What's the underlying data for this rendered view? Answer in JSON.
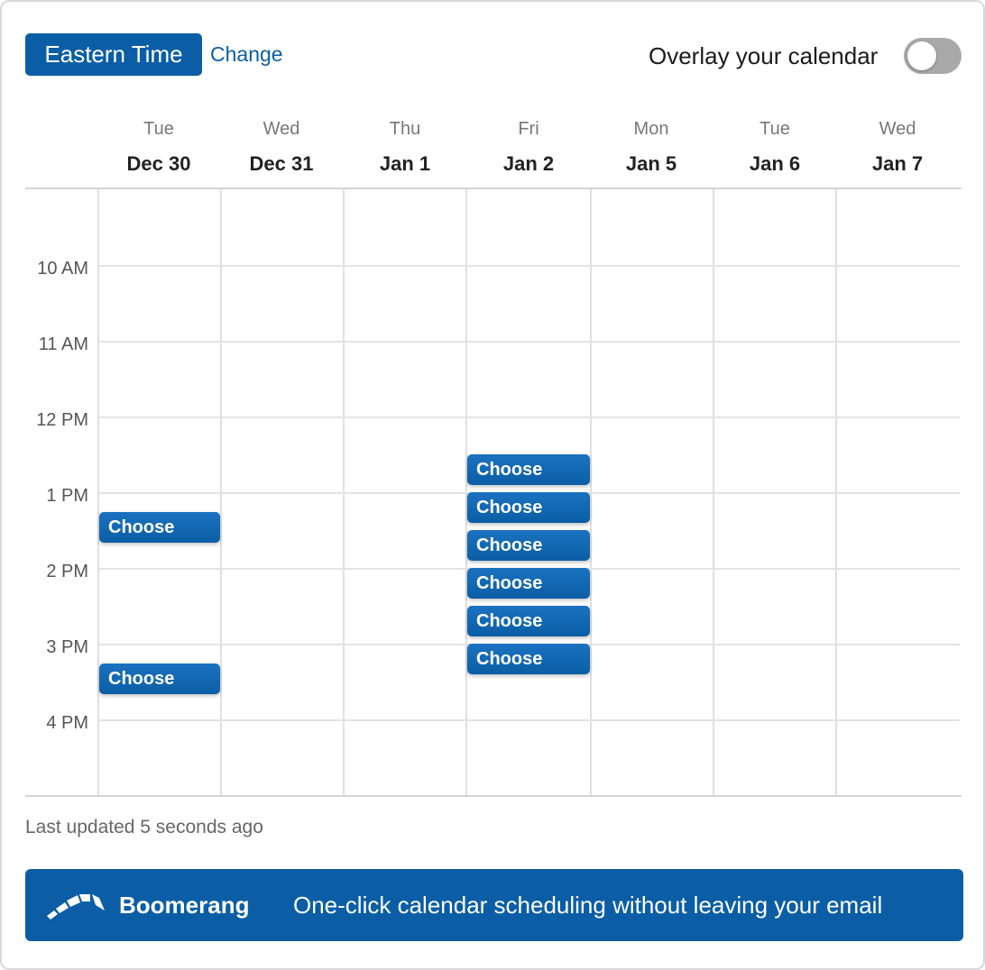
{
  "header": {
    "timezone_label": "Eastern Time",
    "change_label": "Change",
    "overlay_label": "Overlay your calendar",
    "overlay_enabled": false
  },
  "days": [
    {
      "name": "Tue",
      "date": "Dec 30"
    },
    {
      "name": "Wed",
      "date": "Dec 31"
    },
    {
      "name": "Thu",
      "date": "Jan 1"
    },
    {
      "name": "Fri",
      "date": "Jan 2"
    },
    {
      "name": "Mon",
      "date": "Jan 5"
    },
    {
      "name": "Tue",
      "date": "Jan 6"
    },
    {
      "name": "Wed",
      "date": "Jan 7"
    }
  ],
  "time_labels": [
    "10 AM",
    "11 AM",
    "12 PM",
    "1 PM",
    "2 PM",
    "3 PM",
    "4 PM"
  ],
  "slot_label": "Choose",
  "slots": [
    {
      "day": "Dec 30",
      "start": "1:15 PM"
    },
    {
      "day": "Dec 30",
      "start": "3:15 PM"
    },
    {
      "day": "Jan 2",
      "start": "12:30 PM"
    },
    {
      "day": "Jan 2",
      "start": "1:00 PM"
    },
    {
      "day": "Jan 2",
      "start": "1:30 PM"
    },
    {
      "day": "Jan 2",
      "start": "2:00 PM"
    },
    {
      "day": "Jan 2",
      "start": "2:30 PM"
    },
    {
      "day": "Jan 2",
      "start": "3:00 PM"
    }
  ],
  "footer": {
    "last_updated": "Last updated 5 seconds ago"
  },
  "banner": {
    "brand": "Boomerang",
    "tagline": "One-click calendar scheduling without leaving your email",
    "logo_icon": "boomerang-logo-icon"
  },
  "colors": {
    "accent": "#0b5ea5",
    "toggle_off": "#a9a9a9"
  }
}
